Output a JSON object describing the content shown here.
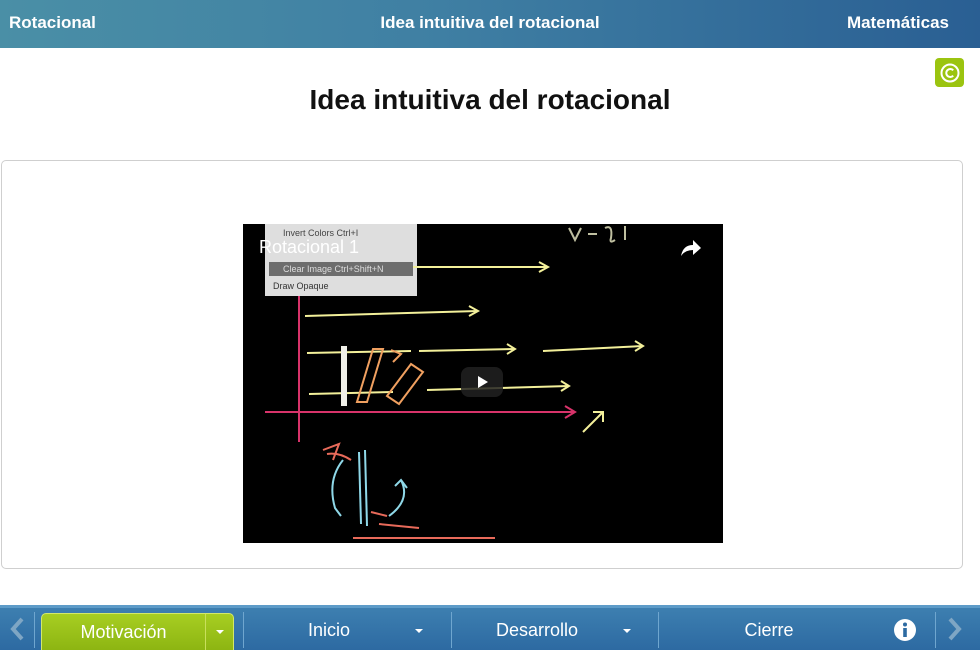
{
  "header": {
    "left_title": "Rotacional",
    "center_title": "Idea intuitiva del rotacional",
    "right_title": "Matemáticas"
  },
  "page": {
    "title": "Idea intuitiva del rotacional"
  },
  "video": {
    "title": "Rotacional 1",
    "menu_items": [
      "Invert Colors   Ctrl+I",
      "Clear Image   Ctrl+Shift+N",
      "Draw Opaque"
    ]
  },
  "bottom_nav": {
    "tabs": [
      {
        "label": "Motivación",
        "active": true
      },
      {
        "label": "Inicio",
        "active": false
      },
      {
        "label": "Desarrollo",
        "active": false
      },
      {
        "label": "Cierre",
        "active": false
      }
    ]
  },
  "colors": {
    "accent_green": "#9bc410",
    "header_blue": "#3f7fa3",
    "footer_blue": "#2d6aa2"
  },
  "icons": {
    "copyright": "copyright-icon",
    "share": "share-icon",
    "play": "play-icon",
    "info": "info-icon",
    "prev": "chevron-left-icon",
    "next": "chevron-right-icon"
  }
}
